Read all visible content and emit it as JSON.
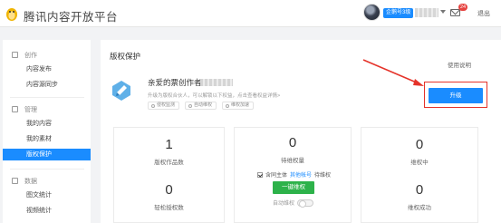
{
  "header": {
    "brand": "腾讯内容开放平台",
    "level_badge": "企鹅号3级",
    "mail_count": "24",
    "logout": "退出"
  },
  "sidebar": {
    "groups": [
      {
        "label": "创作",
        "items": [
          {
            "label": "内容发布"
          },
          {
            "label": "内容源同步"
          }
        ]
      },
      {
        "label": "管理",
        "items": [
          {
            "label": "我的内容"
          },
          {
            "label": "我的素材"
          },
          {
            "label": "版权保护",
            "active": true
          }
        ]
      },
      {
        "label": "数据",
        "items": [
          {
            "label": "图文统计"
          },
          {
            "label": "视频统计"
          }
        ]
      }
    ]
  },
  "main": {
    "title": "版权保护",
    "help_link": "使用说明",
    "greeting": "亲爱的票创作者",
    "intro": "升级为版权合伙人，可以解锁以下权益，点击查看权益详情>",
    "tags": [
      "侵权监测",
      "自动维权",
      "维权加速"
    ],
    "upgrade_button": "升级",
    "stats": {
      "works_count": {
        "value": "1",
        "label": "版权作品数"
      },
      "pending": {
        "value": "0",
        "label": "待维权量",
        "checkbox_prefix": "含同主体",
        "checkbox_link": "其他帐号",
        "checkbox_suffix": "待维权",
        "button": "一键维权",
        "auto_label": "自动维权"
      },
      "in_progress": {
        "value": "0",
        "label": "维权中"
      },
      "light_auth": {
        "value": "0",
        "label": "轻松授权数"
      },
      "success": {
        "value": "0",
        "label": "维权成功"
      }
    }
  },
  "colors": {
    "accent": "#1a8cff",
    "green": "#2db24a",
    "annotation_red": "#e5332a"
  }
}
